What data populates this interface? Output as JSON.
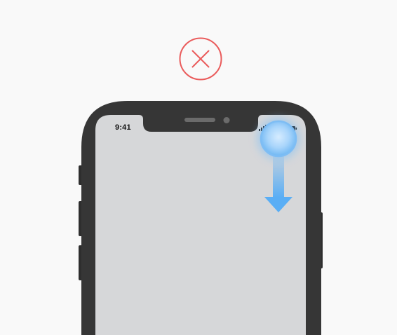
{
  "status_bar": {
    "time": "9:41",
    "signal_icon": "cellular-signal-icon",
    "wifi_icon": "wifi-icon",
    "battery_icon": "battery-icon"
  },
  "error_badge": {
    "icon": "close-icon",
    "color": "#ea5b5b"
  },
  "gesture": {
    "icon": "swipe-down-arrow-icon",
    "color": "#5aaef5"
  },
  "device": {
    "frame_color": "#363636",
    "screen_color": "#d6d7d9"
  }
}
